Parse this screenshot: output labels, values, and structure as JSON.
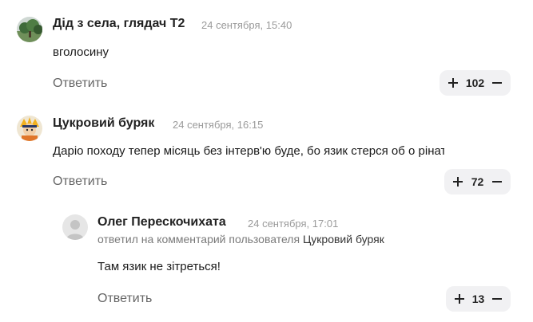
{
  "comments": [
    {
      "author": "Дід з села, глядач Т2",
      "time": "24 сентября, 15:40",
      "text": "вголосину",
      "reply_label": "Ответить",
      "votes": "102"
    },
    {
      "author": "Цукровий буряк",
      "time": "24 сентября, 16:15",
      "text": "Даріо походу тепер місяць без інтерв'ю буде, бо язик стерся об о    ріната",
      "reply_label": "Ответить",
      "votes": "72"
    },
    {
      "author": "Олег Перескочихата",
      "time": "24 сентября, 17:01",
      "reply_prefix": "ответил на комментарий пользователя",
      "reply_to": "Цукровий буряк",
      "text": "Там язик не зітреться!",
      "reply_label": "Ответить",
      "votes": "13"
    }
  ]
}
